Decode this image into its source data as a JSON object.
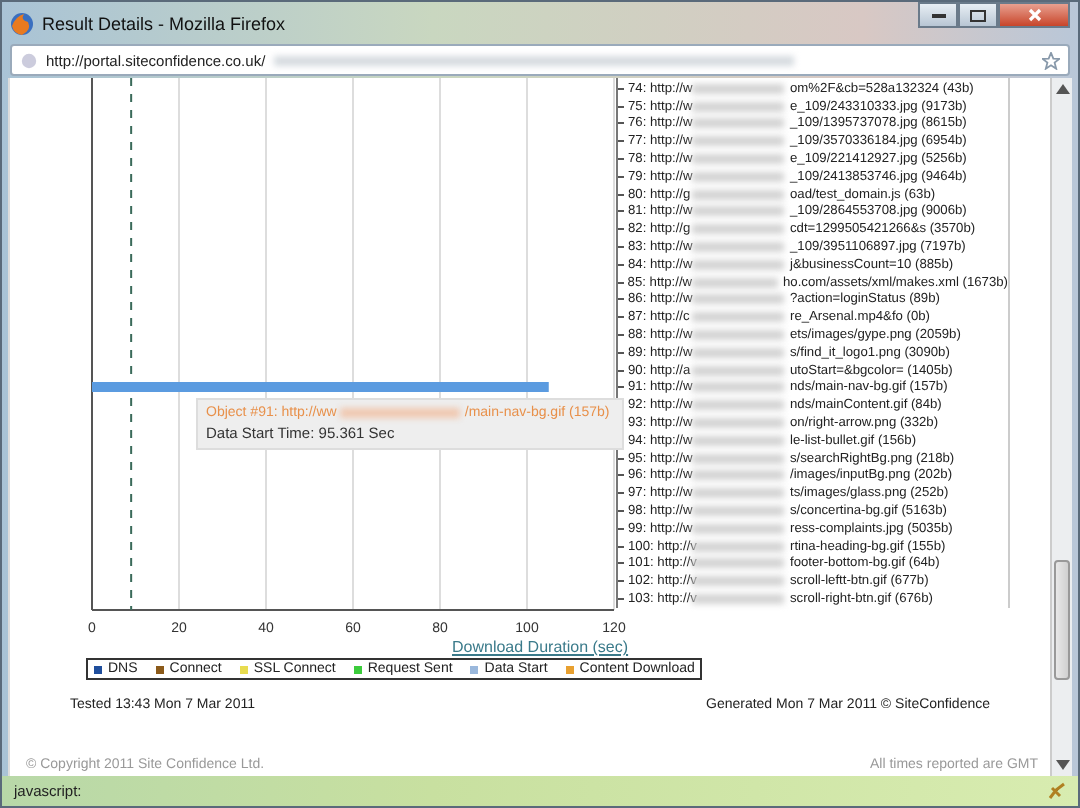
{
  "window": {
    "title": "Result Details - Mozilla Firefox"
  },
  "address_bar": {
    "url": "http://portal.siteconfidence.co.uk/"
  },
  "chart": {
    "chart_data": {
      "type": "bar",
      "orientation": "horizontal",
      "xlabel": "Download Duration (sec)",
      "series": [
        {
          "color": "#5b9be0",
          "values": [
            105
          ]
        }
      ],
      "grid": true,
      "ref_lines": [
        {
          "axis": "x",
          "value": 9,
          "color": "#3a6a5a"
        }
      ],
      "xlim": [
        0,
        120
      ],
      "xticks": [
        0,
        20,
        40,
        60,
        80,
        100,
        120
      ]
    },
    "tooltip": {
      "object": "Object #91: http://ww",
      "object_suffix": "/main-nav-bg.gif (157b)",
      "detail": "Data Start Time: 95.361 Sec"
    },
    "legend": [
      {
        "label": "DNS",
        "color": "#1f4e9c"
      },
      {
        "label": "Connect",
        "color": "#8b5a1a"
      },
      {
        "label": "SSL Connect",
        "color": "#e8dc50"
      },
      {
        "label": "Request Sent",
        "color": "#3ccc3c"
      },
      {
        "label": "Data Start",
        "color": "#9ab8dc"
      },
      {
        "label": "Content Download",
        "color": "#e8a030"
      }
    ]
  },
  "objects": [
    {
      "prefix": "74: http://w",
      "suffix": "om%2F&cb=528a132324 (43b)"
    },
    {
      "prefix": "75: http://w",
      "suffix": "e_109/243310333.jpg (9173b)"
    },
    {
      "prefix": "76: http://w",
      "suffix": "_109/1395737078.jpg (8615b)"
    },
    {
      "prefix": "77: http://w",
      "suffix": "_109/3570336184.jpg (6954b)"
    },
    {
      "prefix": "78: http://w",
      "suffix": "e_109/221412927.jpg (5256b)"
    },
    {
      "prefix": "79: http://w",
      "suffix": "_109/2413853746.jpg (9464b)"
    },
    {
      "prefix": "80: http://g",
      "suffix": "oad/test_domain.js (63b)"
    },
    {
      "prefix": "81: http://w",
      "suffix": "_109/2864553708.jpg (9006b)"
    },
    {
      "prefix": "82: http://g",
      "suffix": "cdt=1299505421266&s (3570b)"
    },
    {
      "prefix": "83: http://w",
      "suffix": "_109/3951106897.jpg (7197b)"
    },
    {
      "prefix": "84: http://w",
      "suffix": "j&businessCount=10 (885b)"
    },
    {
      "prefix": "85: http://w",
      "suffix": "ho.com/assets/xml/makes.xml (1673b)"
    },
    {
      "prefix": "86: http://w",
      "suffix": "?action=loginStatus (89b)"
    },
    {
      "prefix": "87: http://c",
      "suffix": "re_Arsenal.mp4&fo (0b)"
    },
    {
      "prefix": "88: http://w",
      "suffix": "ets/images/gype.png (2059b)"
    },
    {
      "prefix": "89: http://w",
      "suffix": "s/find_it_logo1.png (3090b)"
    },
    {
      "prefix": "90: http://a",
      "suffix": "utoStart=&bgcolor= (1405b)"
    },
    {
      "prefix": "91: http://w",
      "suffix": "nds/main-nav-bg.gif (157b)"
    },
    {
      "prefix": "92: http://w",
      "suffix": "nds/mainContent.gif (84b)"
    },
    {
      "prefix": "93: http://w",
      "suffix": "on/right-arrow.png (332b)"
    },
    {
      "prefix": "94: http://w",
      "suffix": "le-list-bullet.gif (156b)"
    },
    {
      "prefix": "95: http://w",
      "suffix": "s/searchRightBg.png (218b)"
    },
    {
      "prefix": "96: http://w",
      "suffix": "/images/inputBg.png (202b)"
    },
    {
      "prefix": "97: http://w",
      "suffix": "ts/images/glass.png (252b)"
    },
    {
      "prefix": "98: http://w",
      "suffix": "s/concertina-bg.gif (5163b)"
    },
    {
      "prefix": "99: http://w",
      "suffix": "ress-complaints.jpg (5035b)"
    },
    {
      "prefix": "100: http://v",
      "suffix": "rtina-heading-bg.gif (155b)"
    },
    {
      "prefix": "101: http://v",
      "suffix": "footer-bottom-bg.gif (64b)"
    },
    {
      "prefix": "102: http://v",
      "suffix": "scroll-leftt-btn.gif (677b)"
    },
    {
      "prefix": "103: http://v",
      "suffix": "scroll-right-btn.gif (676b)"
    }
  ],
  "tested": "Tested 13:43 Mon 7 Mar 2011",
  "generated": "Generated Mon 7 Mar 2011 © SiteConfidence",
  "footer": {
    "copyright": "© Copyright 2011 Site Confidence Ltd.",
    "timezone": "All times reported are GMT"
  },
  "status_bar": {
    "text": "javascript:"
  }
}
